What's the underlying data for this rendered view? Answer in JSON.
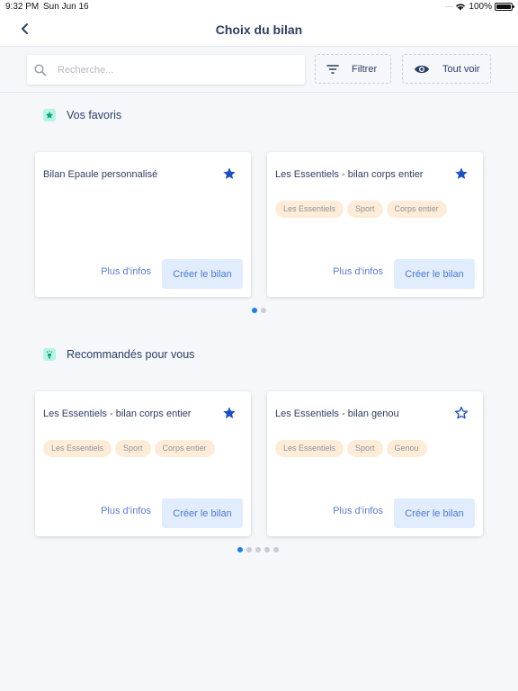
{
  "status_bar": {
    "time": "9:32 PM",
    "date": "Sun Jun 16",
    "battery": "100%",
    "battery_level": 1.0
  },
  "navbar": {
    "back_icon": "chevron-left-icon",
    "title": "Choix du bilan"
  },
  "toolbar": {
    "search_placeholder": "Recherche...",
    "search_value": "",
    "filter_label": "Filtrer",
    "view_all_label": "Tout voir"
  },
  "colors": {
    "accent": "#1a7ef3",
    "star": "#1a4fc4",
    "tag_bg": "#fdebd6",
    "button_bg": "#e1edfd",
    "section_icon_bg": "#b5f5e4"
  },
  "favorites": {
    "title": "Vos favoris",
    "icon": "star-icon",
    "cards": [
      {
        "title": "Bilan Epaule personnalisé",
        "favorite": true,
        "tags": [],
        "more_label": "Plus d'infos",
        "create_label": "Créer le bilan"
      },
      {
        "title": "Les Essentiels - bilan corps entier",
        "favorite": true,
        "tags": [
          "Les Essentiels",
          "Sport",
          "Corps entier"
        ],
        "more_label": "Plus d'infos",
        "create_label": "Créer le bilan"
      }
    ],
    "pages": 2,
    "current_page": 1
  },
  "recommended": {
    "title": "Recommandés pour vous",
    "icon": "lightbulb-icon",
    "cards": [
      {
        "title": "Les Essentiels - bilan corps entier",
        "favorite": true,
        "tags": [
          "Les Essentiels",
          "Sport",
          "Corps entier"
        ],
        "more_label": "Plus d'infos",
        "create_label": "Créer le bilan"
      },
      {
        "title": "Les Essentiels - bilan genou",
        "favorite": false,
        "tags": [
          "Les Essentiels",
          "Sport",
          "Genou"
        ],
        "more_label": "Plus d'infos",
        "create_label": "Créer le bilan"
      }
    ],
    "pages": 5,
    "current_page": 1
  }
}
